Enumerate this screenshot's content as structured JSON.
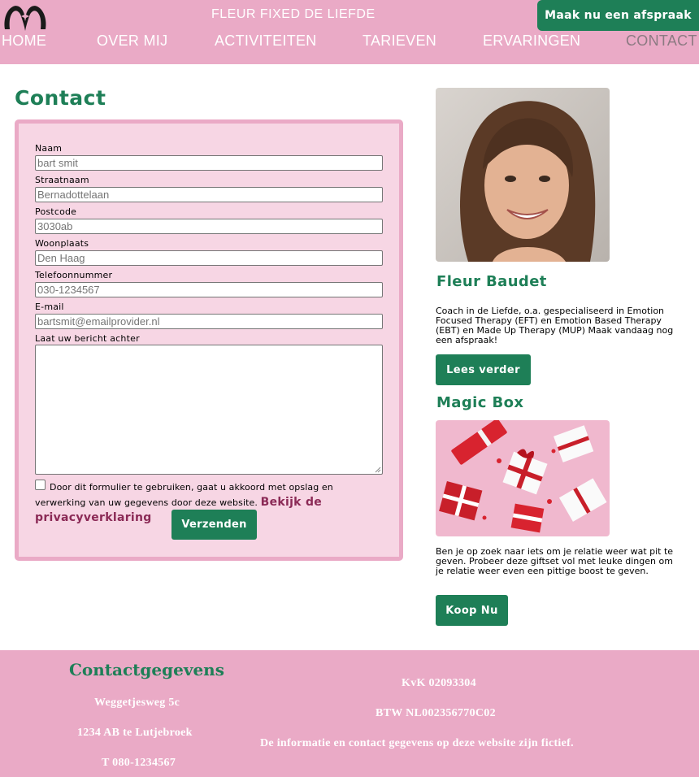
{
  "header": {
    "site_title": "FLEUR FIXED DE LIEFDE",
    "cta_label": "Maak nu een afspraak",
    "nav": [
      {
        "label": "HOME"
      },
      {
        "label": "OVER MIJ"
      },
      {
        "label": "ACTIVITEITEN"
      },
      {
        "label": "TARIEVEN"
      },
      {
        "label": "ERVARINGEN"
      },
      {
        "label": "CONTACT",
        "active": true
      }
    ]
  },
  "main": {
    "title": "Contact",
    "form": {
      "fields": [
        {
          "label": "Naam",
          "placeholder": "bart smit"
        },
        {
          "label": "Straatnaam",
          "placeholder": "Bernadottelaan"
        },
        {
          "label": "Postcode",
          "placeholder": "3030ab"
        },
        {
          "label": "Woonplaats",
          "placeholder": "Den Haag"
        },
        {
          "label": "Telefoonnummer",
          "placeholder": "030-1234567"
        },
        {
          "label": "E-mail",
          "placeholder": "bartsmit@emailprovider.nl"
        }
      ],
      "message_label": "Laat uw bericht achter",
      "consent_text": "Door dit formulier te gebruiken, gaat u akkoord met opslag en verwerking van uw gegevens door deze website.",
      "privacy_link": "Bekijk de privacyverklaring",
      "submit_label": "Verzenden"
    }
  },
  "sidebar": {
    "profile": {
      "name": "Fleur Baudet",
      "description": "Coach in de Liefde, o.a. gespecialiseerd in Emotion Focused Therapy (EFT) en Emotion Based Therapy (EBT) en Made Up Therapy (MUP) Maak vandaag nog een afspraak!",
      "button_label": "Lees verder"
    },
    "product": {
      "name": "Magic Box",
      "description": "Ben je op zoek naar iets om je relatie weer wat pit te geven. Probeer deze giftset vol met leuke dingen om je relatie weer even een pittige boost te geven.",
      "button_label": "Koop Nu"
    }
  },
  "footer": {
    "heading": "Contactgegevens",
    "address_line1": "Weggetjesweg 5c",
    "address_line2": "1234 AB te Lutjebroek",
    "phone": "T 080-1234567",
    "kvk": "KvK 02093304",
    "btw": "BTW NL002356770C02",
    "disclaimer": "De informatie en contact gegevens op deze website zijn fictief."
  },
  "colors": {
    "header_pink": "#eaaac6",
    "form_bg": "#f7d6e4",
    "brand_green": "#1e7f57",
    "link_maroon": "#8b2a56"
  }
}
